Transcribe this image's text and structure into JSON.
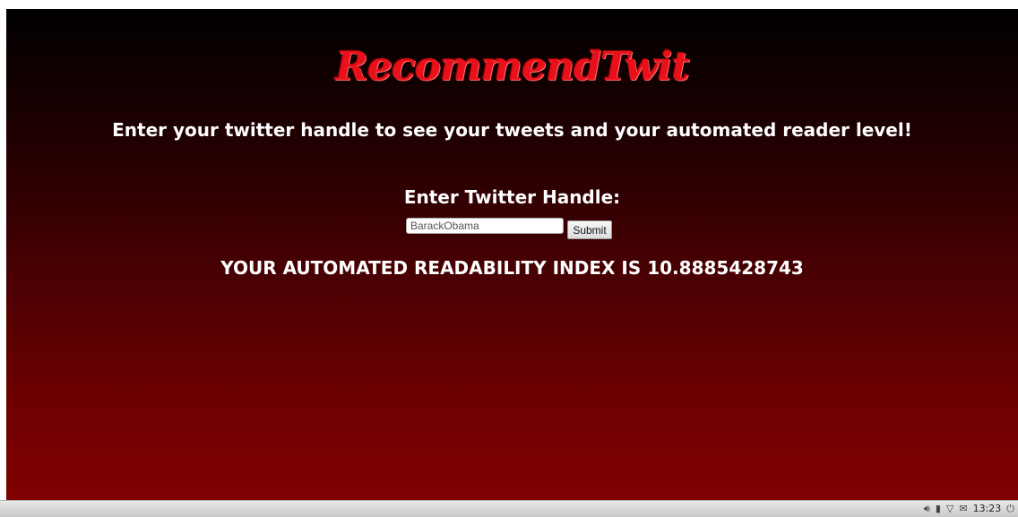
{
  "page": {
    "logo_text": "RecommendTwit",
    "tagline": "Enter your twitter handle to see your tweets and your automated reader level!",
    "form_title": "Enter Twitter Handle:",
    "handle_value": "BarackObama",
    "submit_label": "Submit",
    "result_text": "YOUR AUTOMATED READABILITY INDEX IS 10.8885428743"
  },
  "taskbar": {
    "icons": {
      "volume": "volume-icon",
      "battery": "battery-icon",
      "wifi": "wifi-icon",
      "network": "network-icon",
      "power": "power-icon"
    },
    "clock": "13:23"
  },
  "colors": {
    "logo": "#e8101a",
    "background_top": "#000000",
    "background_bottom": "#800000",
    "text": "#ffffff"
  }
}
